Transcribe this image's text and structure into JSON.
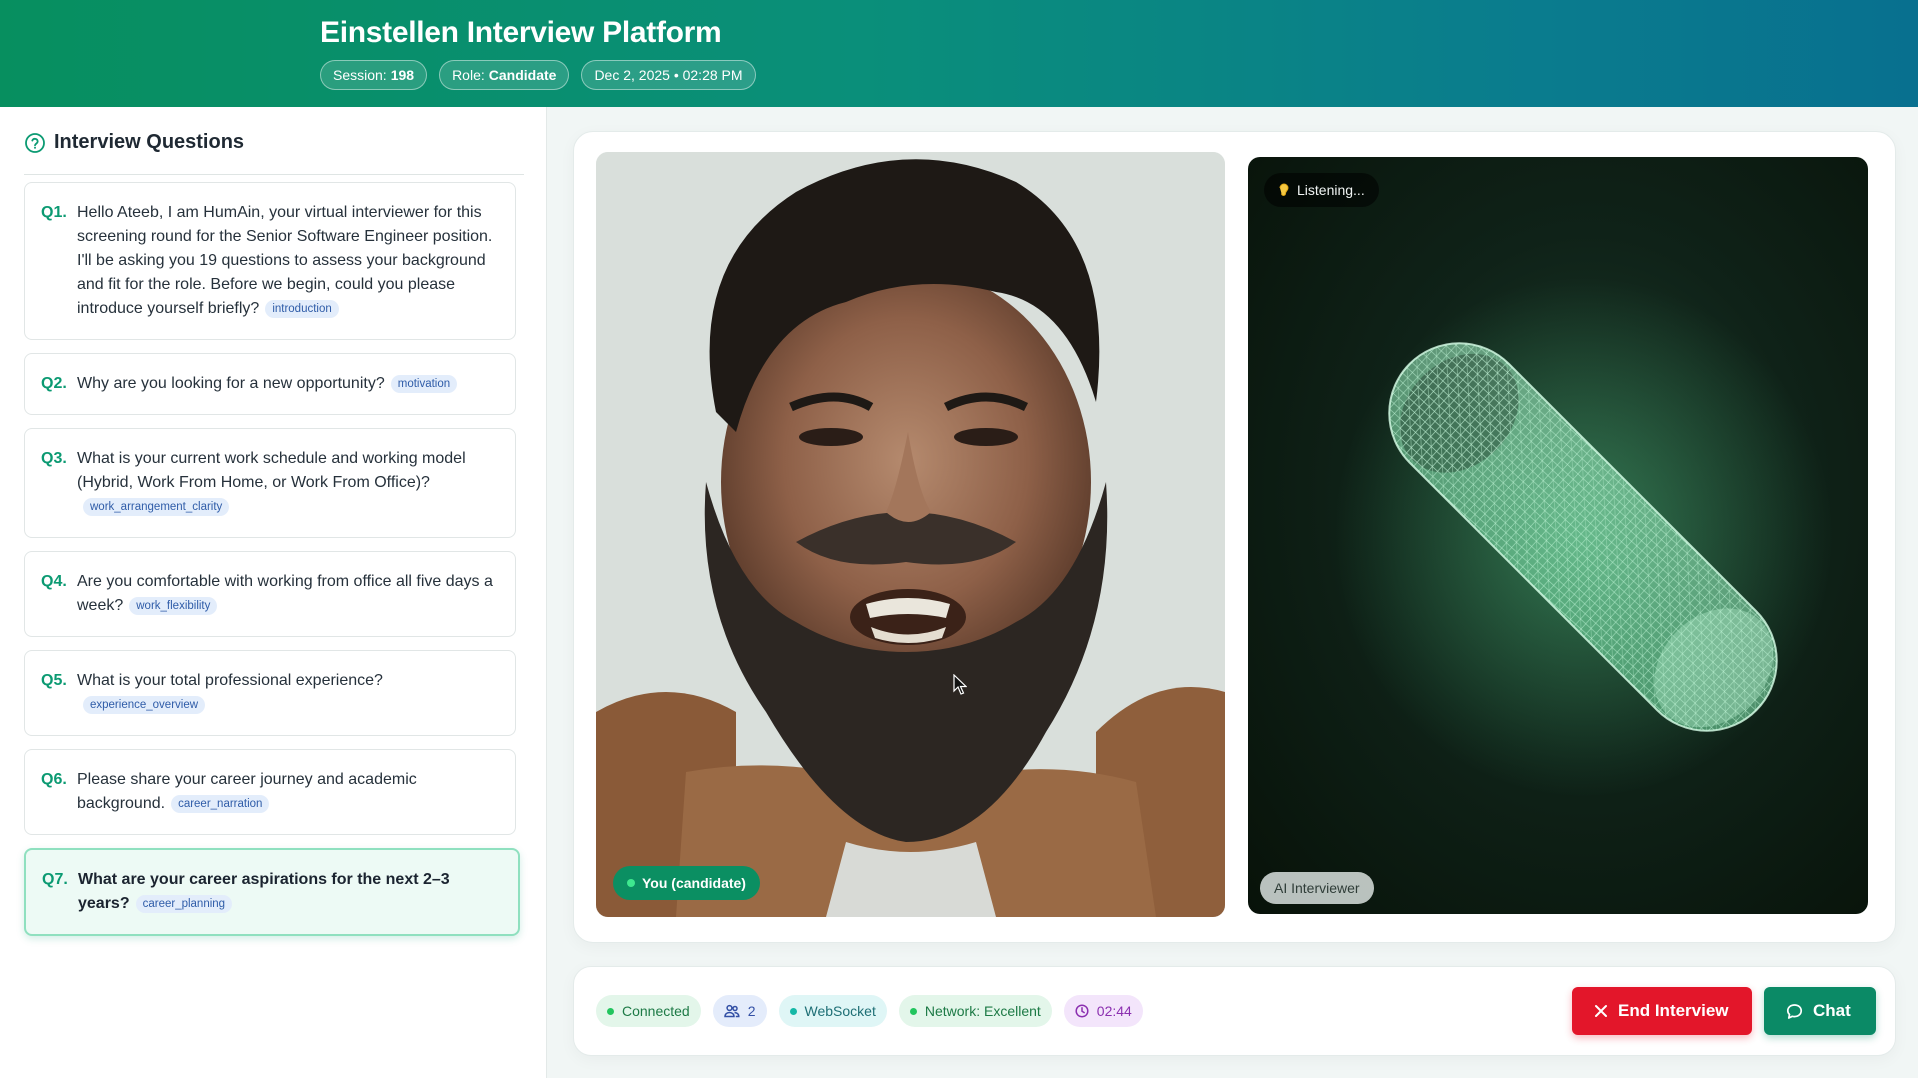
{
  "header": {
    "title": "Einstellen Interview Platform",
    "session_label": "Session:",
    "session_value": "198",
    "role_label": "Role:",
    "role_value": "Candidate",
    "datetime": "Dec 2, 2025 • 02:28 PM"
  },
  "sidebar": {
    "title": "Interview Questions",
    "questions": [
      {
        "num": "Q1.",
        "text": "Hello Ateeb, I am HumAin, your virtual interviewer for this screening round for the Senior Software Engineer position. I'll be asking you 19 questions to assess your background and fit for the role. Before we begin, could you please introduce yourself briefly?",
        "tag": "introduction"
      },
      {
        "num": "Q2.",
        "text": "Why are you looking for a new opportunity?",
        "tag": "motivation"
      },
      {
        "num": "Q3.",
        "text": "What is your current work schedule and working model (Hybrid, Work From Home, or Work From Office)?",
        "tag": "work_arrangement_clarity"
      },
      {
        "num": "Q4.",
        "text": "Are you comfortable with working from office all five days a week?",
        "tag": "work_flexibility"
      },
      {
        "num": "Q5.",
        "text": "What is your total professional experience?",
        "tag": "experience_overview"
      },
      {
        "num": "Q6.",
        "text": "Please share your career journey and academic background.",
        "tag": "career_narration"
      },
      {
        "num": "Q7.",
        "text": "What are your career aspirations for the next 2–3 years?",
        "tag": "career_planning",
        "active": true
      }
    ]
  },
  "video": {
    "candidate_label": "You (candidate)",
    "ai_status": "Listening...",
    "ai_label": "AI Interviewer"
  },
  "status": {
    "connection": "Connected",
    "participants": "2",
    "transport": "WebSocket",
    "network": "Network: Excellent",
    "timer": "02:44"
  },
  "actions": {
    "end_label": "End Interview",
    "chat_label": "Chat"
  },
  "colors": {
    "brand_green": "#0b8a66",
    "danger_red": "#e3162a",
    "active_question_bg": "#edfaf5"
  }
}
